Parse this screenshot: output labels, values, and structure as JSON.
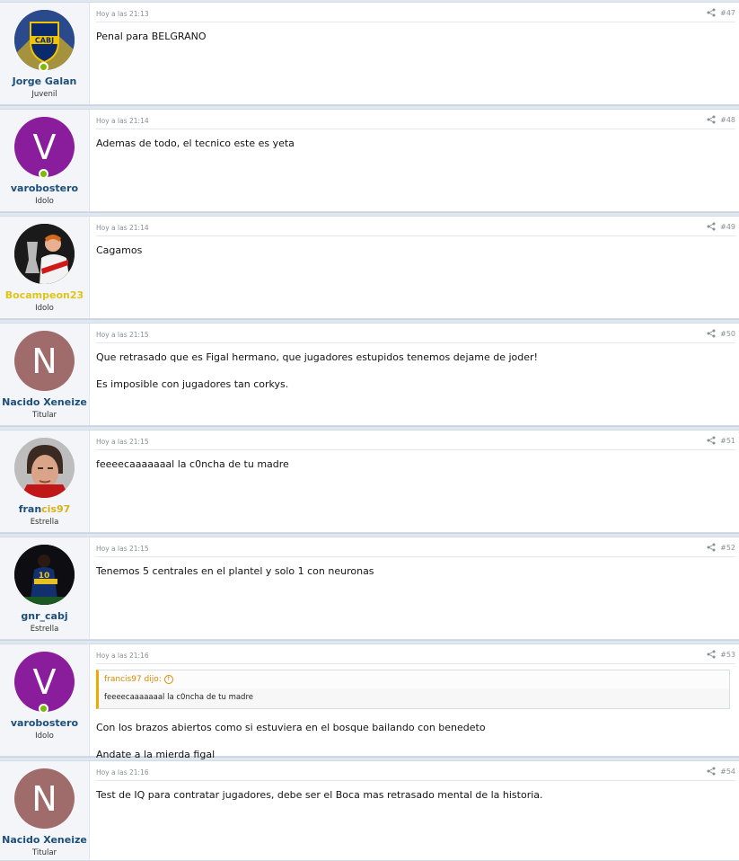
{
  "colors": {
    "username": "#1d4f7a",
    "username_gold": "#e0c41a",
    "online": "#7fb900",
    "quote_accent": "#f0a900"
  },
  "posts": [
    {
      "user": {
        "name": "Jorge Galan",
        "title": "Juvenil",
        "avatar_icon": "cabj-crest-icon"
      },
      "date": "Hoy a las 21:13",
      "num": "#47",
      "paragraphs": [
        "Penal para BELGRANO"
      ]
    },
    {
      "user": {
        "name": "varobostero",
        "title": "Idolo",
        "avatar_letter": "V"
      },
      "date": "Hoy a las 21:14",
      "num": "#48",
      "paragraphs": [
        "Ademas de todo, el tecnico este es yeta"
      ]
    },
    {
      "user": {
        "name": "Bocampeon23",
        "title": "Idolo",
        "avatar_icon": "player-photo-icon"
      },
      "date": "Hoy a las 21:14",
      "num": "#49",
      "paragraphs": [
        "Cagamos"
      ]
    },
    {
      "user": {
        "name": "Nacido Xeneize",
        "title": "Titular",
        "avatar_letter": "N"
      },
      "date": "Hoy a las 21:15",
      "num": "#50",
      "paragraphs": [
        "Que retrasado que es Figal hermano, que jugadores estupidos tenemos dejame de joder!",
        "Es imposible con jugadores tan corkys."
      ]
    },
    {
      "user": {
        "name": "francis97",
        "title": "Estrella",
        "avatar_icon": "man-photo-icon"
      },
      "date": "Hoy a las 21:15",
      "num": "#51",
      "paragraphs": [
        "feeeecaaaaaaal la c0ncha de tu madre"
      ]
    },
    {
      "user": {
        "name": "gnr_cabj",
        "title": "Estrella",
        "avatar_icon": "player-10-photo-icon"
      },
      "date": "Hoy a las 21:15",
      "num": "#52",
      "paragraphs": [
        "Tenemos 5 centrales en el plantel y solo 1 con neuronas"
      ]
    },
    {
      "user": {
        "name": "varobostero",
        "title": "Idolo",
        "avatar_letter": "V"
      },
      "date": "Hoy a las 21:16",
      "num": "#53",
      "quote": {
        "author": "francis97 dijo:",
        "text": "feeeecaaaaaaal la c0ncha de tu madre"
      },
      "paragraphs": [
        "Con los brazos abiertos como si estuviera en el bosque bailando con benedeto",
        "Andate a la mierda figal"
      ]
    },
    {
      "user": {
        "name": "Nacido Xeneize",
        "title": "Titular",
        "avatar_letter": "N"
      },
      "date": "Hoy a las 21:16",
      "num": "#54",
      "paragraphs": [
        "Test de IQ para contratar jugadores, debe ser el Boca mas retrasado mental de la historia."
      ]
    }
  ]
}
